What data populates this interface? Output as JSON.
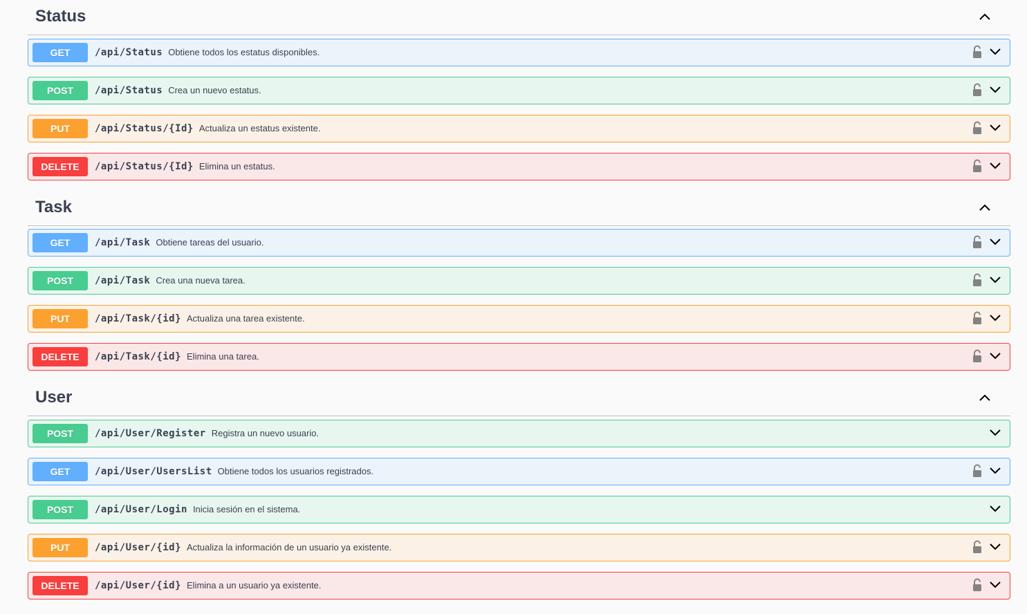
{
  "sections": [
    {
      "title": "Status",
      "operations": [
        {
          "method": "GET",
          "path": "/api/Status",
          "summary": "Obtiene todos los estatus disponibles."
        },
        {
          "method": "POST",
          "path": "/api/Status",
          "summary": "Crea un nuevo estatus."
        },
        {
          "method": "PUT",
          "path": "/api/Status/{Id}",
          "summary": "Actualiza un estatus existente."
        },
        {
          "method": "DELETE",
          "path": "/api/Status/{Id}",
          "summary": "Elimina un estatus."
        }
      ]
    },
    {
      "title": "Task",
      "operations": [
        {
          "method": "GET",
          "path": "/api/Task",
          "summary": "Obtiene tareas del usuario."
        },
        {
          "method": "POST",
          "path": "/api/Task",
          "summary": "Crea una nueva tarea."
        },
        {
          "method": "PUT",
          "path": "/api/Task/{id}",
          "summary": "Actualiza una tarea existente."
        },
        {
          "method": "DELETE",
          "path": "/api/Task/{id}",
          "summary": "Elimina una tarea."
        }
      ]
    },
    {
      "title": "User",
      "operations": [
        {
          "method": "POST",
          "path": "/api/User/Register",
          "summary": "Registra un nuevo usuario."
        },
        {
          "method": "GET",
          "path": "/api/User/UsersList",
          "summary": "Obtiene todos los usuarios registrados."
        },
        {
          "method": "POST",
          "path": "/api/User/Login",
          "summary": "Inicia sesión en el sistema."
        },
        {
          "method": "PUT",
          "path": "/api/User/{id}",
          "summary": "Actualiza la información de un usuario ya existente."
        },
        {
          "method": "DELETE",
          "path": "/api/User/{id}",
          "summary": "Elimina a un usuario ya existente."
        }
      ]
    }
  ],
  "icons": {
    "section_toggle": "chevron-up-icon",
    "lock": "unlocked-padlock-icon",
    "expand": "chevron-down-icon"
  },
  "colors": {
    "GET": "#61affe",
    "POST": "#49cc90",
    "PUT": "#fca130",
    "DELETE": "#f93e3e"
  }
}
